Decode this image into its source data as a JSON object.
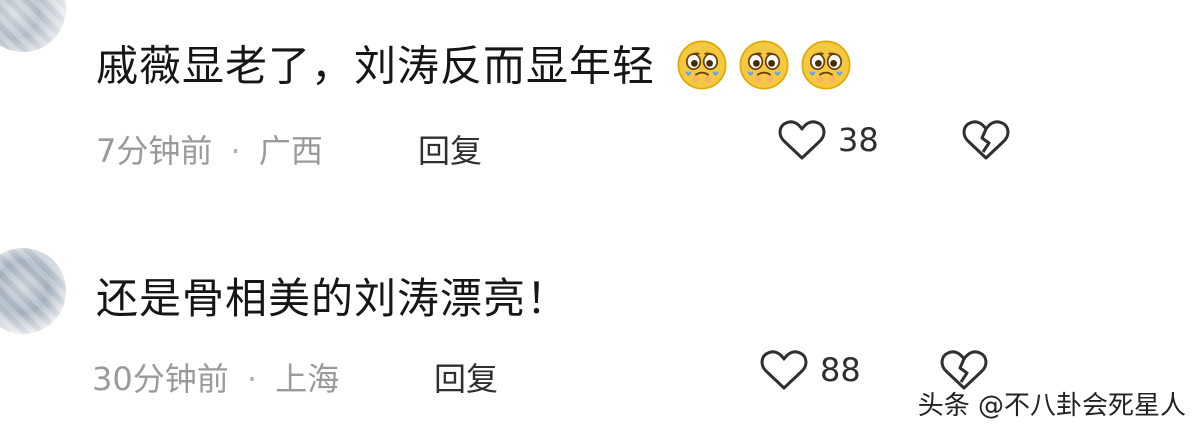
{
  "comments": [
    {
      "text": "戚薇显老了，刘涛反而显年轻",
      "time": "7分钟前",
      "location": "广西",
      "reply_label": "回复",
      "like_count": "38"
    },
    {
      "text": "还是骨相美的刘涛漂亮！",
      "time": "30分钟前",
      "location": "上海",
      "reply_label": "回复",
      "like_count": "88"
    }
  ],
  "separator": "·",
  "watermark": "头条 @不八卦会死星人",
  "icons": {
    "emoji": "pleading-crying-face-emoji",
    "like": "heart-outline-icon",
    "dislike": "broken-heart-icon"
  },
  "colors": {
    "text": "#161616",
    "meta": "#9a9a9a",
    "icon": "#2f2f2f",
    "emoji": "#f5c842"
  }
}
